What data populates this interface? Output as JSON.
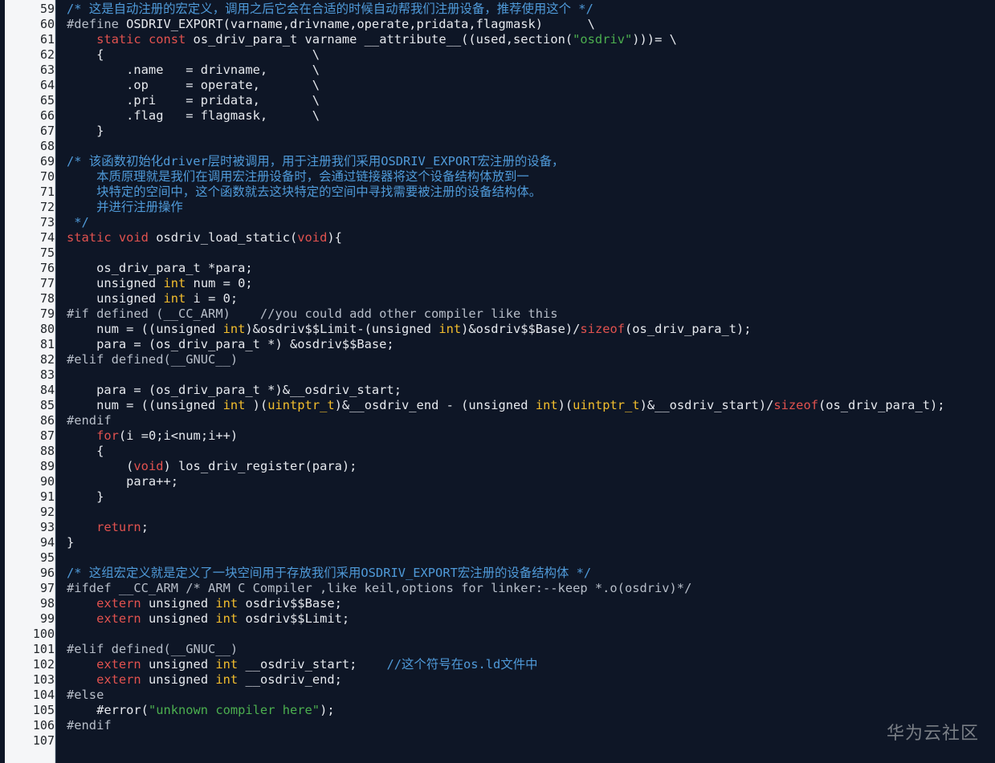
{
  "editor": {
    "line_numbers": [
      "59",
      "60",
      "61",
      "62",
      "63",
      "64",
      "65",
      "66",
      "67",
      "68",
      "69",
      "70",
      "71",
      "72",
      "73",
      "74",
      "75",
      "76",
      "77",
      "78",
      "79",
      "80",
      "81",
      "82",
      "83",
      "84",
      "85",
      "86",
      "87",
      "88",
      "89",
      "90",
      "91",
      "92",
      "93",
      "94",
      "95",
      "96",
      "97",
      "98",
      "99",
      "100",
      "101",
      "102",
      "103",
      "104",
      "105",
      "106",
      "107"
    ],
    "lines": [
      [
        {
          "t": "comment",
          "s": "/* 这是自动注册的宏定义，调用之后它会在合适的时候自动帮我们注册设备，推荐使用这个 */"
        }
      ],
      [
        {
          "t": "preproc",
          "s": "#define "
        },
        {
          "t": "plain",
          "s": "OSDRIV_EXPORT(varname,drivname,operate,pridata,flagmask)      \\"
        }
      ],
      [
        {
          "t": "plain",
          "s": "    "
        },
        {
          "t": "keyword",
          "s": "static const"
        },
        {
          "t": "plain",
          "s": " os_driv_para_t varname __attribute__((used,section("
        },
        {
          "t": "string",
          "s": "\"osdriv\""
        },
        {
          "t": "plain",
          "s": ")))= \\"
        }
      ],
      [
        {
          "t": "plain",
          "s": "    {                            \\"
        }
      ],
      [
        {
          "t": "plain",
          "s": "        .name   = drivname,      \\"
        }
      ],
      [
        {
          "t": "plain",
          "s": "        .op     = operate,       \\"
        }
      ],
      [
        {
          "t": "plain",
          "s": "        .pri    = pridata,       \\"
        }
      ],
      [
        {
          "t": "plain",
          "s": "        .flag   = flagmask,      \\"
        }
      ],
      [
        {
          "t": "plain",
          "s": "    }"
        }
      ],
      [
        {
          "t": "plain",
          "s": ""
        }
      ],
      [
        {
          "t": "comment",
          "s": "/* 该函数初始化driver层时被调用，用于注册我们采用OSDRIV_EXPORT宏注册的设备，"
        }
      ],
      [
        {
          "t": "comment",
          "s": "    本质原理就是我们在调用宏注册设备时，会通过链接器将这个设备结构体放到一"
        }
      ],
      [
        {
          "t": "comment",
          "s": "    块特定的空间中，这个函数就去这块特定的空间中寻找需要被注册的设备结构体。"
        }
      ],
      [
        {
          "t": "comment",
          "s": "    并进行注册操作"
        }
      ],
      [
        {
          "t": "comment",
          "s": " */"
        }
      ],
      [
        {
          "t": "keyword",
          "s": "static void"
        },
        {
          "t": "plain",
          "s": " osdriv_load_static("
        },
        {
          "t": "keyword",
          "s": "void"
        },
        {
          "t": "plain",
          "s": "){"
        }
      ],
      [
        {
          "t": "plain",
          "s": ""
        }
      ],
      [
        {
          "t": "plain",
          "s": "    os_driv_para_t *para;"
        }
      ],
      [
        {
          "t": "plain",
          "s": "    unsigned "
        },
        {
          "t": "type",
          "s": "int"
        },
        {
          "t": "plain",
          "s": " num = 0;"
        }
      ],
      [
        {
          "t": "plain",
          "s": "    unsigned "
        },
        {
          "t": "type",
          "s": "int"
        },
        {
          "t": "plain",
          "s": " i = 0;"
        }
      ],
      [
        {
          "t": "preproc",
          "s": "#if defined (__CC_ARM)    //you could add other compiler like this"
        }
      ],
      [
        {
          "t": "plain",
          "s": "    num = ((unsigned "
        },
        {
          "t": "type",
          "s": "int"
        },
        {
          "t": "plain",
          "s": ")&osdriv$$Limit-(unsigned "
        },
        {
          "t": "type",
          "s": "int"
        },
        {
          "t": "plain",
          "s": ")&osdriv$$Base)/"
        },
        {
          "t": "keyword",
          "s": "sizeof"
        },
        {
          "t": "plain",
          "s": "(os_driv_para_t);"
        }
      ],
      [
        {
          "t": "plain",
          "s": "    para = (os_driv_para_t *) &osdriv$$Base;"
        }
      ],
      [
        {
          "t": "preproc",
          "s": "#elif defined(__GNUC__)"
        }
      ],
      [
        {
          "t": "plain",
          "s": ""
        }
      ],
      [
        {
          "t": "plain",
          "s": "    para = (os_driv_para_t *)&__osdriv_start;"
        }
      ],
      [
        {
          "t": "plain",
          "s": "    num = ((unsigned "
        },
        {
          "t": "type",
          "s": "int"
        },
        {
          "t": "plain",
          "s": " )("
        },
        {
          "t": "type",
          "s": "uintptr_t"
        },
        {
          "t": "plain",
          "s": ")&__osdriv_end - (unsigned "
        },
        {
          "t": "type",
          "s": "int"
        },
        {
          "t": "plain",
          "s": ")("
        },
        {
          "t": "type",
          "s": "uintptr_t"
        },
        {
          "t": "plain",
          "s": ")&__osdriv_start)/"
        },
        {
          "t": "keyword",
          "s": "sizeof"
        },
        {
          "t": "plain",
          "s": "(os_driv_para_t);"
        }
      ],
      [
        {
          "t": "preproc",
          "s": "#endif"
        }
      ],
      [
        {
          "t": "plain",
          "s": "    "
        },
        {
          "t": "keyword",
          "s": "for"
        },
        {
          "t": "plain",
          "s": "(i =0;i<num;i++)"
        }
      ],
      [
        {
          "t": "plain",
          "s": "    {"
        }
      ],
      [
        {
          "t": "plain",
          "s": "        ("
        },
        {
          "t": "keyword",
          "s": "void"
        },
        {
          "t": "plain",
          "s": ") los_driv_register(para);"
        }
      ],
      [
        {
          "t": "plain",
          "s": "        para++;"
        }
      ],
      [
        {
          "t": "plain",
          "s": "    }"
        }
      ],
      [
        {
          "t": "plain",
          "s": ""
        }
      ],
      [
        {
          "t": "plain",
          "s": "    "
        },
        {
          "t": "keyword",
          "s": "return"
        },
        {
          "t": "plain",
          "s": ";"
        }
      ],
      [
        {
          "t": "plain",
          "s": "}"
        }
      ],
      [
        {
          "t": "plain",
          "s": ""
        }
      ],
      [
        {
          "t": "comment",
          "s": "/* 这组宏定义就是定义了一块空间用于存放我们采用OSDRIV_EXPORT宏注册的设备结构体 */"
        }
      ],
      [
        {
          "t": "preproc",
          "s": "#ifdef __CC_ARM /* ARM C Compiler ,like keil,options for linker:--keep *.o(osdriv)*/"
        }
      ],
      [
        {
          "t": "plain",
          "s": "    "
        },
        {
          "t": "keyword",
          "s": "extern"
        },
        {
          "t": "plain",
          "s": " unsigned "
        },
        {
          "t": "type",
          "s": "int"
        },
        {
          "t": "plain",
          "s": " osdriv$$Base;"
        }
      ],
      [
        {
          "t": "plain",
          "s": "    "
        },
        {
          "t": "keyword",
          "s": "extern"
        },
        {
          "t": "plain",
          "s": " unsigned "
        },
        {
          "t": "type",
          "s": "int"
        },
        {
          "t": "plain",
          "s": " osdriv$$Limit;"
        }
      ],
      [
        {
          "t": "plain",
          "s": ""
        }
      ],
      [
        {
          "t": "preproc",
          "s": "#elif defined(__GNUC__)"
        }
      ],
      [
        {
          "t": "plain",
          "s": "    "
        },
        {
          "t": "keyword",
          "s": "extern"
        },
        {
          "t": "plain",
          "s": " unsigned "
        },
        {
          "t": "type",
          "s": "int"
        },
        {
          "t": "plain",
          "s": " __osdriv_start;    "
        },
        {
          "t": "comment",
          "s": "//这个符号在os.ld文件中"
        }
      ],
      [
        {
          "t": "plain",
          "s": "    "
        },
        {
          "t": "keyword",
          "s": "extern"
        },
        {
          "t": "plain",
          "s": " unsigned "
        },
        {
          "t": "type",
          "s": "int"
        },
        {
          "t": "plain",
          "s": " __osdriv_end;"
        }
      ],
      [
        {
          "t": "preproc",
          "s": "#else"
        }
      ],
      [
        {
          "t": "plain",
          "s": "    #error("
        },
        {
          "t": "string",
          "s": "\"unknown compiler here\""
        },
        {
          "t": "plain",
          "s": ");"
        }
      ],
      [
        {
          "t": "preproc",
          "s": "#endif"
        }
      ],
      [
        {
          "t": "plain",
          "s": ""
        }
      ]
    ]
  },
  "watermark": {
    "text": "华为云社区"
  },
  "colors": {
    "background": "#0e1626",
    "comment": "#4f9ad9",
    "keyword": "#e2524f",
    "type": "#f4bf2d",
    "string": "#4caf4f",
    "plain": "#e6e9ee",
    "gutter": "#f5f6f8"
  }
}
